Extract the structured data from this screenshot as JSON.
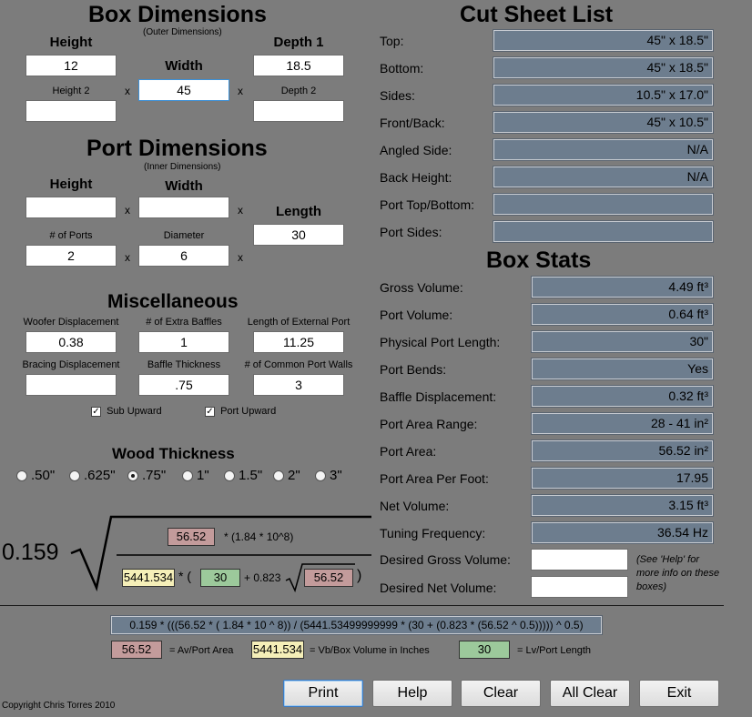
{
  "box_dimensions": {
    "title": "Box Dimensions",
    "subtitle": "(Outer Dimensions)",
    "height_label": "Height",
    "height_value": "12",
    "width_label": "Width",
    "width_value": "45",
    "depth1_label": "Depth 1",
    "depth1_value": "18.5",
    "height2_label": "Height 2",
    "height2_value": "",
    "depth2_label": "Depth 2",
    "depth2_value": ""
  },
  "port_dimensions": {
    "title": "Port Dimensions",
    "subtitle": "(Inner Dimensions)",
    "height_label": "Height",
    "height_value": "",
    "width_label": "Width",
    "width_value": "",
    "length_label": "Length",
    "length_value": "30",
    "ports_label": "# of Ports",
    "ports_value": "2",
    "diameter_label": "Diameter",
    "diameter_value": "6"
  },
  "times": "x",
  "misc": {
    "title": "Miscellaneous",
    "woofer_label": "Woofer Displacement",
    "woofer_value": "0.38",
    "baffles_label": "# of Extra Baffles",
    "baffles_value": "1",
    "ext_port_label": "Length of External Port",
    "ext_port_value": "11.25",
    "bracing_label": "Bracing Displacement",
    "bracing_value": "",
    "baffle_thk_label": "Baffle Thickness",
    "baffle_thk_value": ".75",
    "common_walls_label": "# of Common Port Walls",
    "common_walls_value": "3",
    "sub_upward_label": "Sub Upward",
    "sub_upward_checked": true,
    "port_upward_label": "Port Upward",
    "port_upward_checked": true,
    "check_mark": "✓"
  },
  "wood_thickness": {
    "title": "Wood Thickness",
    "options": [
      ".50\"",
      ".625\"",
      ".75\"",
      "1\"",
      "1.5\"",
      "2\"",
      "3\""
    ],
    "selected": ".75\""
  },
  "formula": {
    "constant": "0.159",
    "top_red": "56.52",
    "top_text": "* (1.84 * 10^8)",
    "bottom_yellow": "5441.534",
    "star_paren": "* (",
    "bottom_green": "30",
    "plus_text": "+ 0.823",
    "bottom_red": "56.52",
    "close_paren": ")",
    "expression": "0.159 * (((56.52 * ( 1.84 * 10 ^ 8)) / (5441.53499999999 * (30 + (0.823 * (56.52 ^ 0.5))))) ^ 0.5)",
    "legend_red": "56.52",
    "legend_red_text": "= Av/Port Area",
    "legend_yellow": "5441.534",
    "legend_yellow_text": "= Vb/Box Volume in Inches",
    "legend_green": "30",
    "legend_green_text": "= Lv/Port Length"
  },
  "cut_sheet": {
    "title": "Cut Sheet List",
    "rows": [
      {
        "label": "Top:",
        "value": "45\" x 18.5\""
      },
      {
        "label": "Bottom:",
        "value": "45\" x 18.5\""
      },
      {
        "label": "Sides:",
        "value": "10.5\" x 17.0\""
      },
      {
        "label": "Front/Back:",
        "value": "45\" x 10.5\""
      },
      {
        "label": "Angled Side:",
        "value": "N/A"
      },
      {
        "label": "Back Height:",
        "value": "N/A"
      },
      {
        "label": "Port Top/Bottom:",
        "value": ""
      },
      {
        "label": "Port Sides:",
        "value": ""
      }
    ]
  },
  "box_stats": {
    "title": "Box Stats",
    "rows": [
      {
        "label": "Gross Volume:",
        "value": "4.49 ft³"
      },
      {
        "label": "Port Volume:",
        "value": "0.64 ft³"
      },
      {
        "label": "Physical Port Length:",
        "value": "30\""
      },
      {
        "label": "Port Bends:",
        "value": "Yes"
      },
      {
        "label": "Baffle Displacement:",
        "value": "0.32 ft³"
      },
      {
        "label": "Port Area Range:",
        "value": "28 - 41 in²"
      },
      {
        "label": "Port Area:",
        "value": "56.52 in²"
      },
      {
        "label": "Port Area Per Foot:",
        "value": "17.95"
      },
      {
        "label": "Net Volume:",
        "value": "3.15 ft³"
      },
      {
        "label": "Tuning Frequency:",
        "value": "36.54 Hz"
      }
    ],
    "desired_gross_label": "Desired Gross Volume:",
    "desired_gross_value": "",
    "desired_net_label": "Desired Net Volume:",
    "desired_net_value": "",
    "help_note": "(See 'Help' for more info on these boxes)"
  },
  "buttons": {
    "print": "Print",
    "help": "Help",
    "clear": "Clear",
    "all_clear": "All Clear",
    "exit": "Exit"
  },
  "copyright": "Copyright Chris Torres 2010"
}
